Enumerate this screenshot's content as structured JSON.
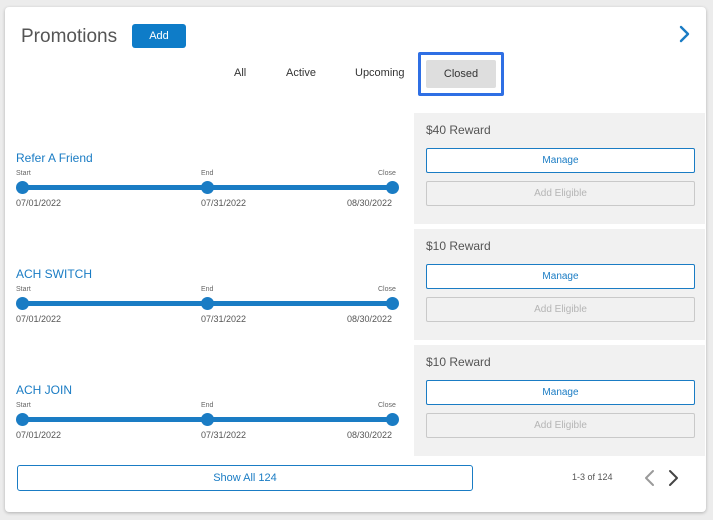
{
  "header": {
    "title": "Promotions",
    "add_label": "Add"
  },
  "tabs": [
    {
      "label": "All"
    },
    {
      "label": "Active"
    },
    {
      "label": "Upcoming"
    },
    {
      "label": "Closed",
      "selected": true
    }
  ],
  "timeline_labels": {
    "start": "Start",
    "end": "End",
    "close": "Close"
  },
  "promotions": [
    {
      "name": "Refer A Friend",
      "start": "07/01/2022",
      "end": "07/31/2022",
      "close": "08/30/2022",
      "reward": "$40 Reward",
      "manage_label": "Manage",
      "eligible_label": "Add Eligible"
    },
    {
      "name": "ACH SWITCH",
      "start": "07/01/2022",
      "end": "07/31/2022",
      "close": "08/30/2022",
      "reward": "$10 Reward",
      "manage_label": "Manage",
      "eligible_label": "Add Eligible"
    },
    {
      "name": "ACH JOIN",
      "start": "07/01/2022",
      "end": "07/31/2022",
      "close": "08/30/2022",
      "reward": "$10 Reward",
      "manage_label": "Manage",
      "eligible_label": "Add Eligible"
    }
  ],
  "footer": {
    "show_all_label": "Show All 124",
    "pager_text": "1-3 of 124"
  },
  "colors": {
    "accent": "#1a7cc4",
    "selected_tab_outline": "#2f6fe4",
    "panel_bg": "#f1f1f1"
  }
}
